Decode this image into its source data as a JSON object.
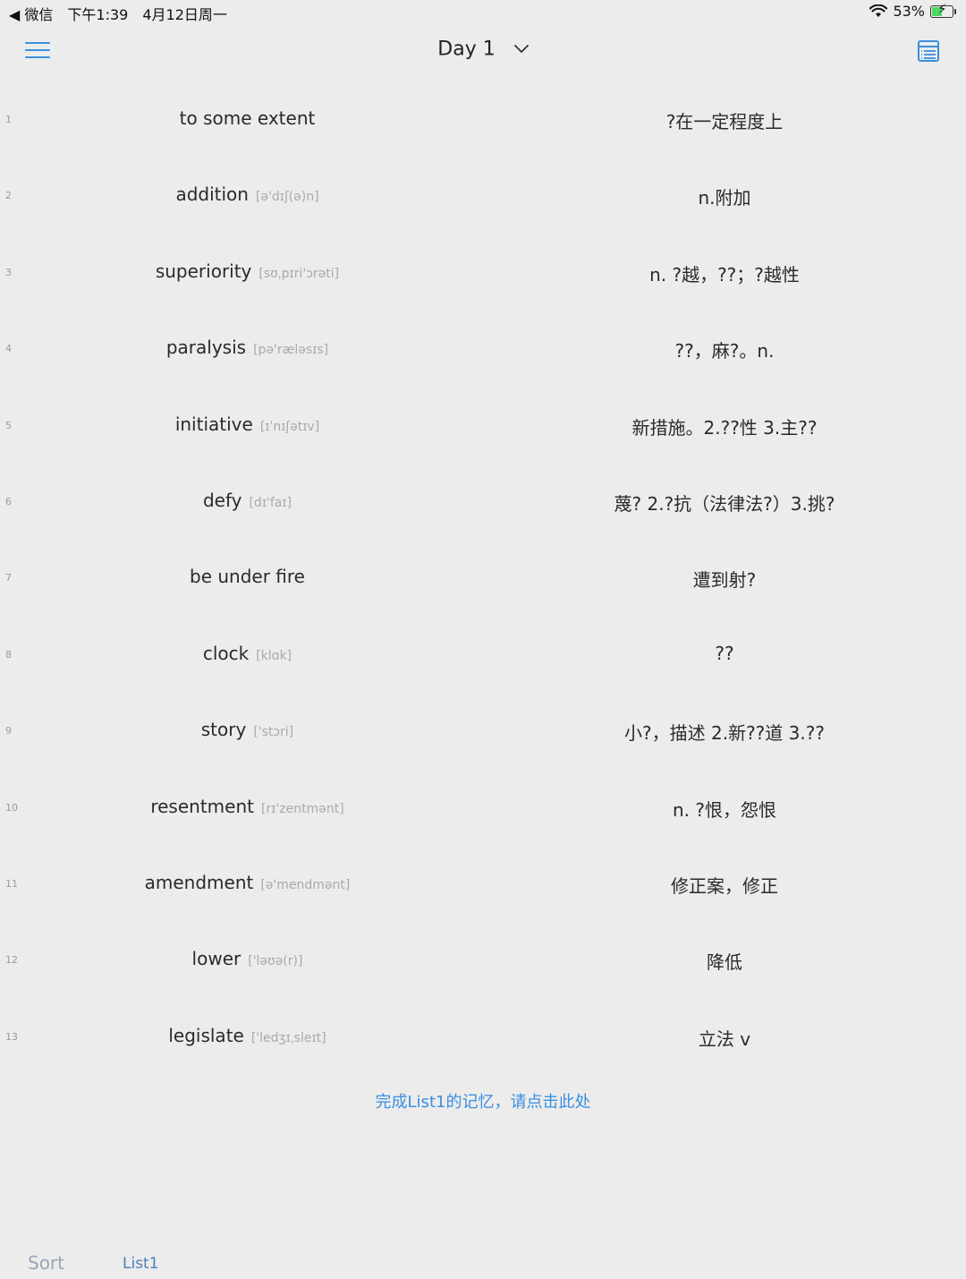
{
  "status_bar": {
    "back_app": "◀ 微信",
    "time": "下午1:39",
    "date": "4月12日周一",
    "battery": "53%",
    "battery_level": 0.53
  },
  "nav": {
    "title": "Day 1",
    "icons": {
      "menu": "hamburger-menu-icon",
      "dropdown": "chevron-down-icon",
      "view": "list-view-icon"
    },
    "accent_color": "#3a8fe0"
  },
  "words": [
    {
      "num": "1",
      "word": "to some extent",
      "phonetic": "",
      "meaning": "?在一定程度上"
    },
    {
      "num": "2",
      "word": "addition",
      "phonetic": "[ə'dɪʃ(ə)n]",
      "meaning": "n.附加"
    },
    {
      "num": "3",
      "word": "superiority",
      "phonetic": "[sʊˌpɪri'ɔrəti]",
      "meaning": "n. ?越，??；?越性"
    },
    {
      "num": "4",
      "word": "paralysis",
      "phonetic": "[pə'ræləsɪs]",
      "meaning": "??，麻?。n."
    },
    {
      "num": "5",
      "word": "initiative",
      "phonetic": "[ɪˈnɪʃətɪv]",
      "meaning": "新措施。2.??性 3.主??"
    },
    {
      "num": "6",
      "word": "defy",
      "phonetic": "[dɪ'faɪ]",
      "meaning": "蔑? 2.?抗（法律法?）3.挑?"
    },
    {
      "num": "7",
      "word": "be under fire",
      "phonetic": "",
      "meaning": "遭到射?"
    },
    {
      "num": "8",
      "word": "clock",
      "phonetic": "[klɑk]",
      "meaning": "??"
    },
    {
      "num": "9",
      "word": "story",
      "phonetic": "['stɔri]",
      "meaning": "小?，描述 2.新??道 3.??"
    },
    {
      "num": "10",
      "word": "resentment",
      "phonetic": "[rɪ'zentmənt]",
      "meaning": "n. ?恨，怨恨"
    },
    {
      "num": "11",
      "word": "amendment",
      "phonetic": "[ə'mendmənt]",
      "meaning": "修正案，修正"
    },
    {
      "num": "12",
      "word": "lower",
      "phonetic": "['ləʊə(r)]",
      "meaning": "降低"
    },
    {
      "num": "13",
      "word": "legislate",
      "phonetic": "['ledʒɪˌsleɪt]",
      "meaning": "立法 v"
    }
  ],
  "finish_link": "完成List1的记忆，请点击此处",
  "bottom_tabs": {
    "sort": "Sort",
    "list1": "List1"
  }
}
